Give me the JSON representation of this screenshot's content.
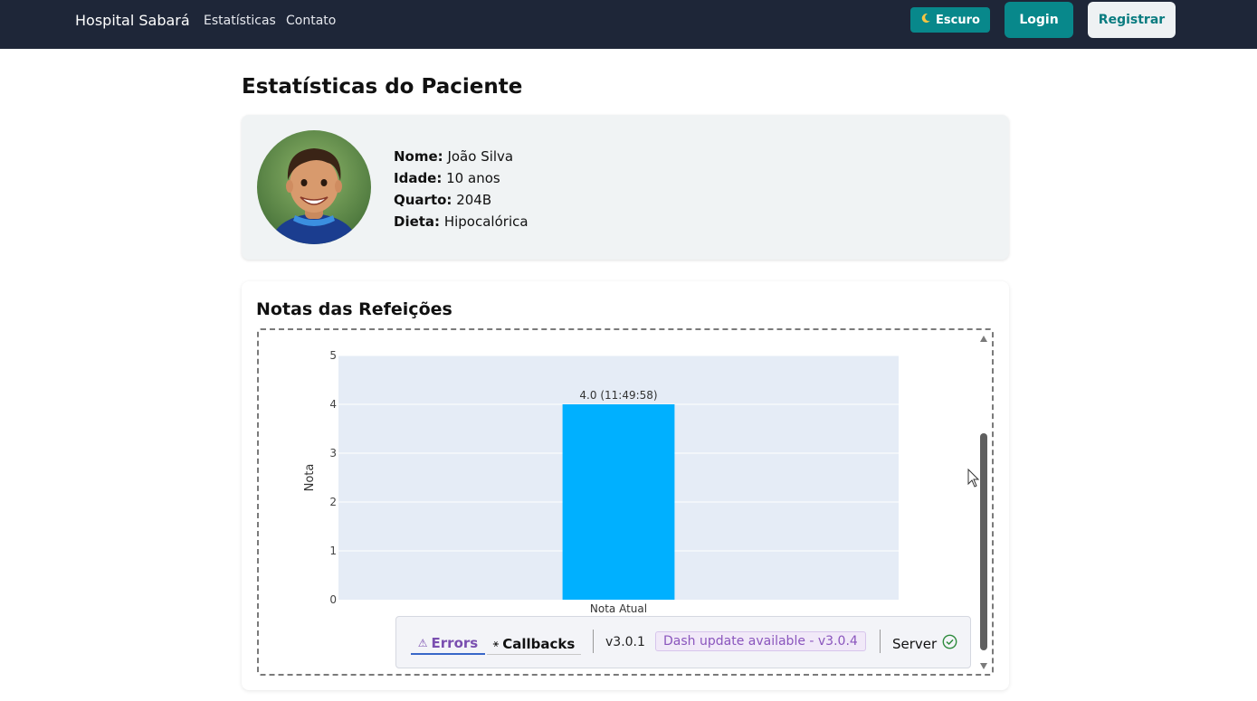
{
  "navbar": {
    "brand": "Hospital Sabará",
    "links": [
      "Estatísticas",
      "Contato"
    ],
    "theme_icon": "moon-icon",
    "theme_label": "Escuro",
    "login_label": "Login",
    "register_label": "Registrar"
  },
  "page": {
    "title": "Estatísticas do Paciente"
  },
  "patient": {
    "name_label": "Nome:",
    "name_value": "João Silva",
    "age_label": "Idade:",
    "age_value": "10 anos",
    "room_label": "Quarto:",
    "room_value": "204B",
    "diet_label": "Dieta:",
    "diet_value": "Hipocalórica"
  },
  "notes": {
    "title": "Notas das Refeições"
  },
  "chart_data": {
    "type": "bar",
    "categories": [
      "Nota Atual"
    ],
    "values": [
      4.0
    ],
    "data_labels": [
      "4.0 (11:49:58)"
    ],
    "xlabel": "",
    "ylabel": "Nota",
    "ylim": [
      0,
      5
    ],
    "yticks": [
      0,
      1,
      2,
      3,
      4,
      5
    ],
    "bar_color": "#00b0ff",
    "plot_bg": "#e5ecf6",
    "grid": true
  },
  "devtools": {
    "errors_label": "Errors",
    "callbacks_label": "Callbacks",
    "version": "v3.0.1",
    "update_text": "Dash update available - v3.0.4",
    "server_label": "Server",
    "accent": "#7a4fb0"
  }
}
